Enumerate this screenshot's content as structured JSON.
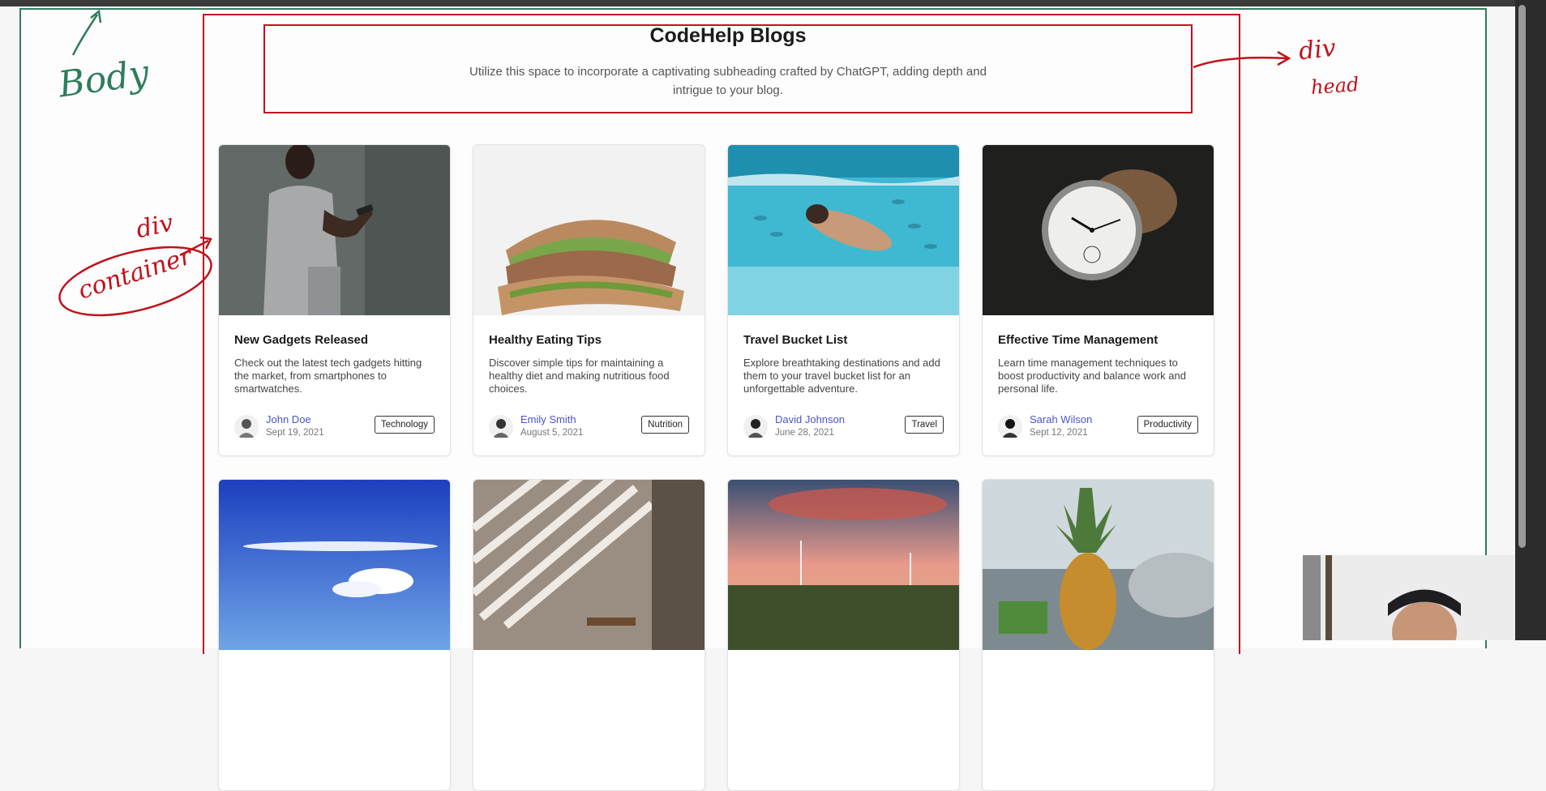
{
  "header": {
    "title": "CodeHelp Blogs",
    "subtitle": "Utilize this space to incorporate a captivating subheading crafted by ChatGPT, adding depth and intrigue to your blog."
  },
  "cards": [
    {
      "title": "New Gadgets Released",
      "desc": "Check out the latest tech gadgets hitting the market, from smartphones to smartwatches.",
      "author": "John Doe",
      "date": "Sept 19, 2021",
      "tag": "Technology"
    },
    {
      "title": "Healthy Eating Tips",
      "desc": "Discover simple tips for maintaining a healthy diet and making nutritious food choices.",
      "author": "Emily Smith",
      "date": "August 5, 2021",
      "tag": "Nutrition"
    },
    {
      "title": "Travel Bucket List",
      "desc": "Explore breathtaking destinations and add them to your travel bucket list for an unforgettable adventure.",
      "author": "David Johnson",
      "date": "June 28, 2021",
      "tag": "Travel"
    },
    {
      "title": "Effective Time Management",
      "desc": "Learn time management techniques to boost productivity and balance work and personal life.",
      "author": "Sarah Wilson",
      "date": "Sept 12, 2021",
      "tag": "Productivity"
    }
  ],
  "annotations": {
    "body": "Body",
    "container_div": "div",
    "container": "container",
    "heading_div": "div",
    "heading": "head"
  },
  "colors": {
    "body_outline": "#2e7d5b",
    "container_outline": "#c0121c",
    "author_link": "#4b55c8"
  }
}
